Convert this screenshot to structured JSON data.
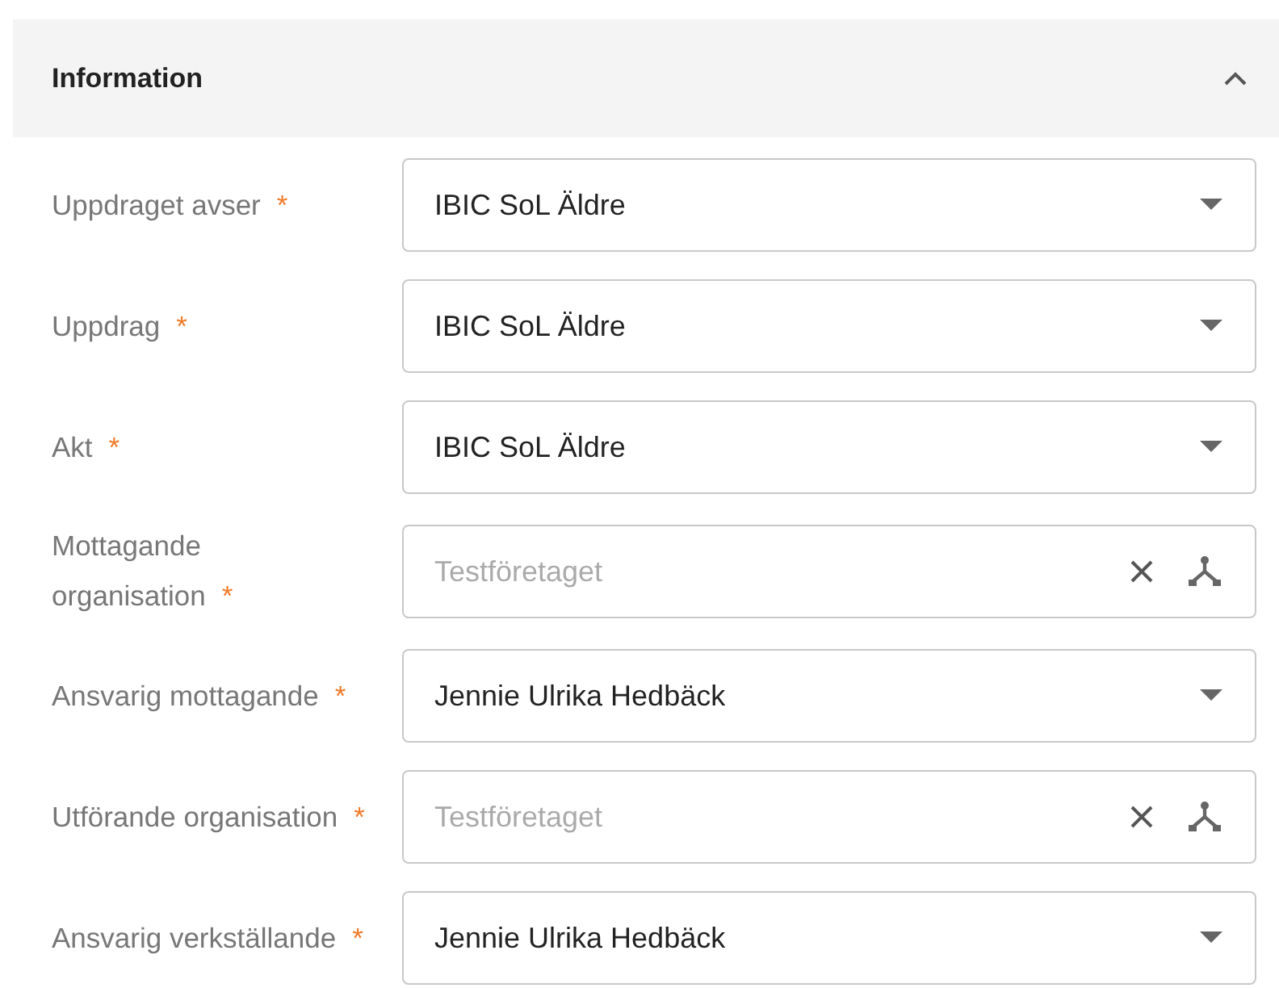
{
  "section": {
    "title": "Information",
    "expanded": true
  },
  "fields": [
    {
      "label": "Uppdraget avser",
      "marker": "*",
      "kind": "select",
      "value": "IBIC SoL Äldre"
    },
    {
      "label": "Uppdrag",
      "marker": "*",
      "kind": "select",
      "value": "IBIC SoL Äldre"
    },
    {
      "label": "Akt",
      "marker": "*",
      "kind": "select",
      "value": "IBIC SoL Äldre"
    },
    {
      "label": "Mottagande organisation",
      "marker": "*",
      "kind": "lookup",
      "placeholder": "Testföretaget"
    },
    {
      "label": "Ansvarig mottagande",
      "marker": "*",
      "kind": "select",
      "value": "Jennie Ulrika Hedbäck"
    },
    {
      "label": "Utförande organisation",
      "marker": "*",
      "kind": "lookup",
      "placeholder": "Testföretaget"
    },
    {
      "label": "Ansvarig verkställande",
      "marker": "*",
      "kind": "select",
      "value": "Jennie Ulrika Hedbäck"
    }
  ]
}
